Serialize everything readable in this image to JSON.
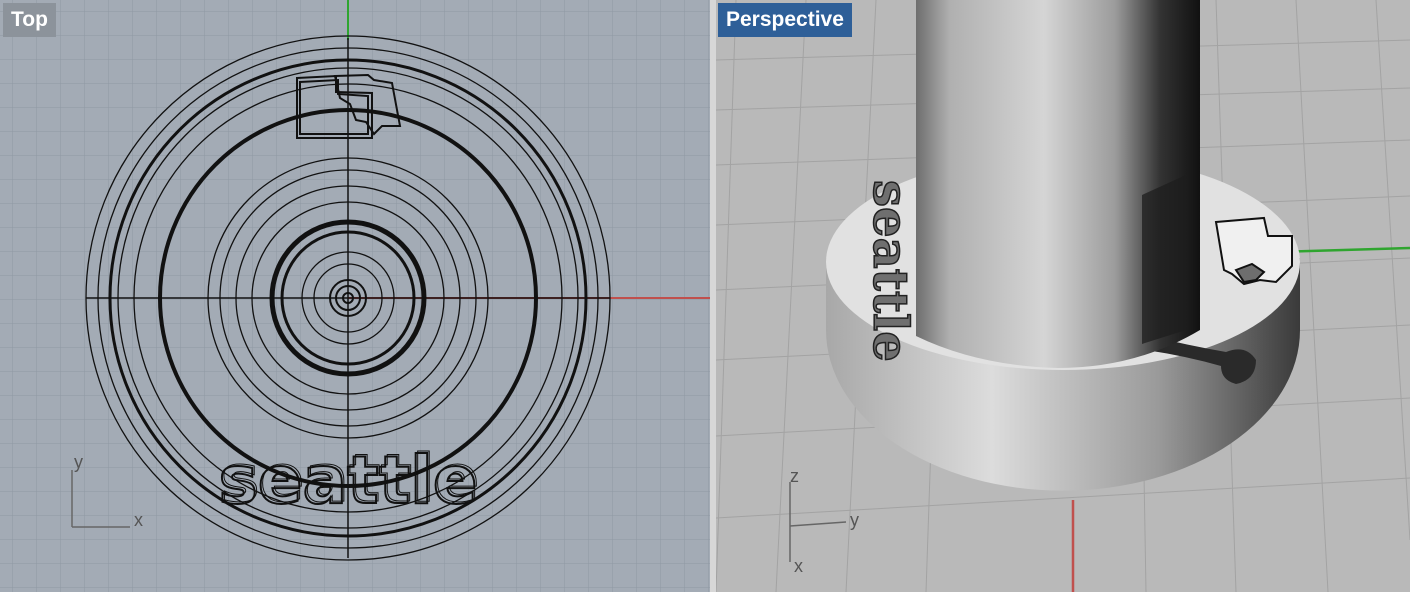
{
  "viewports": {
    "top": {
      "label": "Top",
      "axis_x": "x",
      "axis_y": "y",
      "engraved_text": "seattle"
    },
    "perspective": {
      "label": "Perspective",
      "axis_z": "z",
      "axis_y": "y",
      "axis_x": "x",
      "engraved_text": "seattle"
    }
  },
  "colors": {
    "top_bg": "#a3abb5",
    "perspective_bg": "#b9b9b9",
    "active_label_bg": "#2e5f98",
    "inactive_label_bg": "#8c939b",
    "x_axis": "#c0504d",
    "y_axis": "#2fa52f"
  }
}
